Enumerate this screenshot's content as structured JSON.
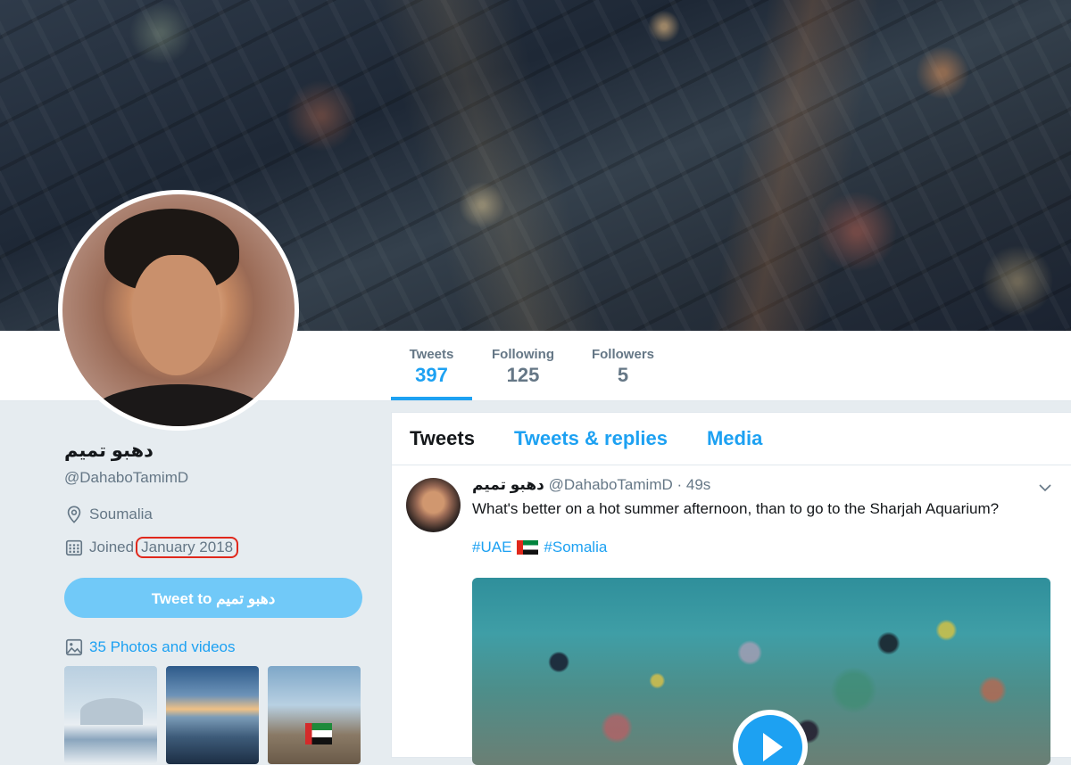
{
  "profile": {
    "name": "دهبو تميم",
    "handle": "@DahaboTamimD",
    "location": "Soumalia",
    "joined_prefix": "Joined",
    "joined_date": "January 2018",
    "tweet_to_label": "Tweet to دهبو تميم",
    "photos_label": "35 Photos and videos"
  },
  "stats": [
    {
      "label": "Tweets",
      "value": "397",
      "active": true
    },
    {
      "label": "Following",
      "value": "125",
      "active": false
    },
    {
      "label": "Followers",
      "value": "5",
      "active": false
    }
  ],
  "timeline": {
    "tabs": [
      {
        "label": "Tweets",
        "active": true
      },
      {
        "label": "Tweets & replies",
        "active": false
      },
      {
        "label": "Media",
        "active": false
      }
    ],
    "tweet": {
      "name": "دهبو تميم",
      "handle": "@DahaboTamimD",
      "time": "· 49s",
      "text": "What's better on a hot summer afternoon, than to go to the Sharjah Aquarium?",
      "hashtag1": "#UAE",
      "hashtag2": "#Somalia"
    }
  },
  "icons": {
    "location": "location-pin-icon",
    "calendar": "calendar-icon",
    "photos": "image-icon",
    "chevron": "chevron-down-icon",
    "play": "play-icon",
    "flag": "uae-flag-icon"
  },
  "colors": {
    "accent": "#1da1f2",
    "tweet_button": "#71c9f8",
    "highlight_annotation": "#e0281c"
  }
}
